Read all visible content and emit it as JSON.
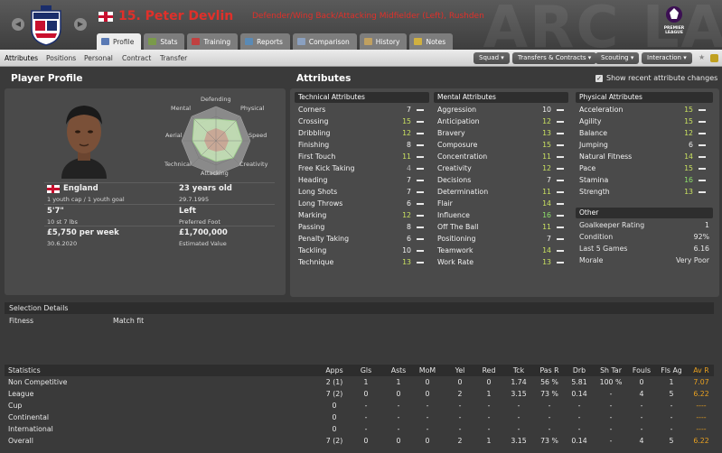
{
  "header": {
    "title": "15. Peter Devlin",
    "subtitle": "Defender/Wing Back/Attacking Midfielder (Left), Rushden",
    "bg_text": "ARC LA",
    "tabs": [
      {
        "label": "Profile",
        "icon": "profile-icon",
        "color": "#5a7ab5"
      },
      {
        "label": "Stats",
        "icon": "stats-icon",
        "color": "#7a9a4a"
      },
      {
        "label": "Training",
        "icon": "training-icon",
        "color": "#c04040"
      },
      {
        "label": "Reports",
        "icon": "reports-icon",
        "color": "#5a8ab5"
      },
      {
        "label": "Comparison",
        "icon": "comparison-icon",
        "color": "#8aa0c0"
      },
      {
        "label": "History",
        "icon": "history-icon",
        "color": "#c0a060"
      },
      {
        "label": "Notes",
        "icon": "notes-icon",
        "color": "#d0b040"
      }
    ]
  },
  "subnav": {
    "items": [
      "Attributes",
      "Positions",
      "Personal",
      "Contract",
      "Transfer"
    ],
    "buttons": [
      "Squad",
      "Transfers & Contracts",
      "Scouting",
      "Interaction"
    ]
  },
  "profile": {
    "section_title": "Player Profile",
    "radar_labels": {
      "defending": "Defending",
      "physical": "Physical",
      "speed": "Speed",
      "creativity": "Creativity",
      "attacking": "Attacking",
      "technical": "Technical",
      "aerial": "Aerial",
      "mental": "Mental"
    },
    "nationality": "England",
    "caps": "1 youth cap / 1 youth goal",
    "age": "23 years old",
    "dob": "29.7.1995",
    "height": "5'7\"",
    "weight": "10 st 7 lbs",
    "foot": "Left",
    "foot_label": "Preferred Foot",
    "wage": "£5,750 per week",
    "contract_date": "30.6.2020",
    "value": "£1,700,000",
    "value_label": "Estimated Value"
  },
  "attributes": {
    "section_title": "Attributes",
    "show_recent_label": "Show recent attribute changes",
    "technical": {
      "title": "Technical Attributes",
      "items": [
        {
          "name": "Corners",
          "value": "7"
        },
        {
          "name": "Crossing",
          "value": "15"
        },
        {
          "name": "Dribbling",
          "value": "12"
        },
        {
          "name": "Finishing",
          "value": "8"
        },
        {
          "name": "First Touch",
          "value": "11"
        },
        {
          "name": "Free Kick Taking",
          "value": "4"
        },
        {
          "name": "Heading",
          "value": "7"
        },
        {
          "name": "Long Shots",
          "value": "7"
        },
        {
          "name": "Long Throws",
          "value": "6"
        },
        {
          "name": "Marking",
          "value": "12"
        },
        {
          "name": "Passing",
          "value": "8"
        },
        {
          "name": "Penalty Taking",
          "value": "6"
        },
        {
          "name": "Tackling",
          "value": "10"
        },
        {
          "name": "Technique",
          "value": "13"
        }
      ]
    },
    "mental": {
      "title": "Mental Attributes",
      "items": [
        {
          "name": "Aggression",
          "value": "10"
        },
        {
          "name": "Anticipation",
          "value": "12"
        },
        {
          "name": "Bravery",
          "value": "13"
        },
        {
          "name": "Composure",
          "value": "15"
        },
        {
          "name": "Concentration",
          "value": "11"
        },
        {
          "name": "Creativity",
          "value": "12"
        },
        {
          "name": "Decisions",
          "value": "7"
        },
        {
          "name": "Determination",
          "value": "11"
        },
        {
          "name": "Flair",
          "value": "14"
        },
        {
          "name": "Influence",
          "value": "16"
        },
        {
          "name": "Off The Ball",
          "value": "11"
        },
        {
          "name": "Positioning",
          "value": "7"
        },
        {
          "name": "Teamwork",
          "value": "14"
        },
        {
          "name": "Work Rate",
          "value": "13"
        }
      ]
    },
    "physical": {
      "title": "Physical Attributes",
      "items": [
        {
          "name": "Acceleration",
          "value": "15"
        },
        {
          "name": "Agility",
          "value": "15"
        },
        {
          "name": "Balance",
          "value": "12"
        },
        {
          "name": "Jumping",
          "value": "6"
        },
        {
          "name": "Natural Fitness",
          "value": "14"
        },
        {
          "name": "Pace",
          "value": "15"
        },
        {
          "name": "Stamina",
          "value": "16"
        },
        {
          "name": "Strength",
          "value": "13"
        }
      ]
    },
    "other": {
      "title": "Other",
      "items": [
        {
          "name": "Goalkeeper Rating",
          "value": "1"
        },
        {
          "name": "Condition",
          "value": "92%"
        },
        {
          "name": "Last 5 Games",
          "value": "6.16"
        },
        {
          "name": "Morale",
          "value": "Very Poor"
        }
      ]
    }
  },
  "selection": {
    "title": "Selection Details",
    "fitness_label": "Fitness",
    "fitness_value": "Match fit"
  },
  "stats": {
    "title": "Statistics",
    "columns": [
      "Apps",
      "Gls",
      "Asts",
      "MoM",
      "Yel",
      "Red",
      "Tck",
      "Pas R",
      "Drb",
      "Sh Tar",
      "Fouls",
      "Fls Ag",
      "Av R"
    ],
    "rows": [
      {
        "label": "Non Competitive",
        "cells": [
          "2 (1)",
          "1",
          "1",
          "0",
          "0",
          "0",
          "1.74",
          "56 %",
          "5.81",
          "100 %",
          "0",
          "1",
          "7.07"
        ]
      },
      {
        "label": "League",
        "cells": [
          "7 (2)",
          "0",
          "0",
          "0",
          "2",
          "1",
          "3.15",
          "73 %",
          "0.14",
          "-",
          "4",
          "5",
          "6.22"
        ]
      },
      {
        "label": "Cup",
        "cells": [
          "0",
          "-",
          "-",
          "-",
          "-",
          "-",
          "-",
          "-",
          "-",
          "-",
          "-",
          "-",
          "----"
        ]
      },
      {
        "label": "Continental",
        "cells": [
          "0",
          "-",
          "-",
          "-",
          "-",
          "-",
          "-",
          "-",
          "-",
          "-",
          "-",
          "-",
          "----"
        ]
      },
      {
        "label": "International",
        "cells": [
          "0",
          "-",
          "-",
          "-",
          "-",
          "-",
          "-",
          "-",
          "-",
          "-",
          "-",
          "-",
          "----"
        ]
      },
      {
        "label": "Overall",
        "cells": [
          "7 (2)",
          "0",
          "0",
          "0",
          "2",
          "1",
          "3.15",
          "73 %",
          "0.14",
          "-",
          "4",
          "5",
          "6.22"
        ]
      }
    ]
  },
  "colors": {
    "title_red": "#e0302a",
    "attr_high": "#c8e060",
    "attr_top": "#8ee06a",
    "attr_mid": "#f0f0f0",
    "attr_low": "#b0b0b0",
    "avr_orange": "#e8a020"
  }
}
